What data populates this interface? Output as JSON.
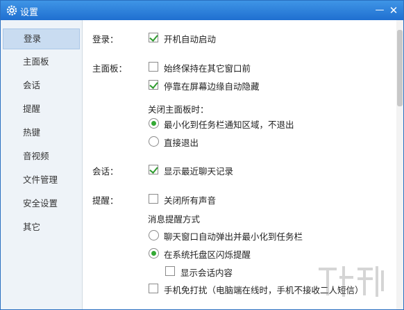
{
  "window": {
    "title": "设置",
    "minimize_glyph": "—",
    "close_glyph": "✕"
  },
  "sidebar": {
    "items": [
      {
        "label": "登录",
        "active": true
      },
      {
        "label": "主面板"
      },
      {
        "label": "会话"
      },
      {
        "label": "提醒"
      },
      {
        "label": "热键"
      },
      {
        "label": "音视频"
      },
      {
        "label": "文件管理"
      },
      {
        "label": "安全设置"
      },
      {
        "label": "其它"
      }
    ]
  },
  "content": {
    "login": {
      "label": "登录：",
      "autostart": {
        "text": "开机自动启动",
        "checked": true
      }
    },
    "panel": {
      "label": "主面板：",
      "always_on_top": {
        "text": "始终保持在其它窗口前",
        "checked": false
      },
      "dock_autohide": {
        "text": "停靠在屏幕边缘自动隐藏",
        "checked": true
      },
      "close_heading": "关闭主面板时：",
      "close_minimize": {
        "text": "最小化到任务栏通知区域，不退出",
        "selected": true
      },
      "close_exit": {
        "text": "直接退出",
        "selected": false
      }
    },
    "chat": {
      "label": "会话：",
      "show_recent": {
        "text": "显示最近聊天记录",
        "checked": true
      }
    },
    "remind": {
      "label": "提醒：",
      "mute_all": {
        "text": "关闭所有声音",
        "checked": false
      },
      "method_heading": "消息提醒方式",
      "popup_window": {
        "text": "聊天窗口自动弹出并最小化到任务栏",
        "selected": false
      },
      "tray_flash": {
        "text": "在系统托盘区闪烁提醒",
        "selected": true
      },
      "show_content": {
        "text": "显示会话内容",
        "checked": false
      },
      "mobile_dnd": {
        "text": "手机免打扰（电脑端在线时，手机不接收二人短信）",
        "checked": false
      }
    }
  },
  "icons": {
    "title": "gear-icon"
  },
  "colors": {
    "titlebar": "#2a7ad8",
    "sidebar_bg": "#eef3f8",
    "active_item": "#c9dcf1",
    "check": "#2e9b2e",
    "radio": "#34a934"
  }
}
